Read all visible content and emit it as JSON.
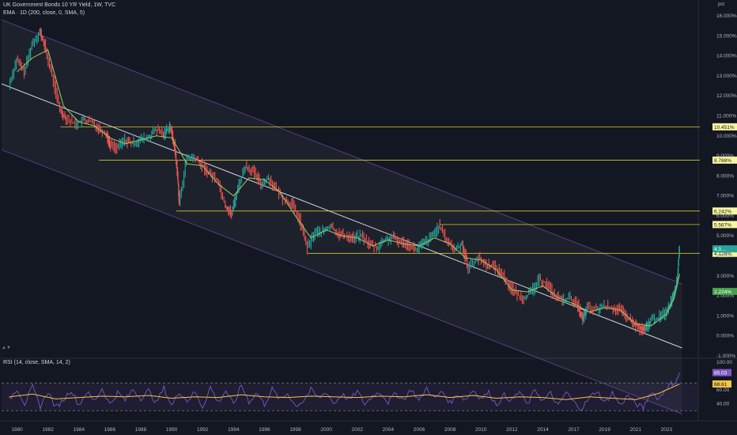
{
  "header": {
    "title": "UK Government Bonds 10 YR Yield, 1W, TVC",
    "ema_legend": "EMA · 1D (200, close, 0, SMA, 5)",
    "rsi_legend": "RSI (14, close, SMA, 14, 2)",
    "unit": "pct"
  },
  "colors": {
    "background": "#131722",
    "up": "#26a69a",
    "down": "#ef5350",
    "ema": "#9ccc65",
    "trendline": "#d1d4dc",
    "channel": "#7e57c2",
    "level": "#d4c62a",
    "label_bg": "#fbf7a0",
    "rsi": "#7e57c2",
    "rsi_ma": "#f5c542"
  },
  "chart_data": [
    {
      "type": "line",
      "title": "UK Government Bonds 10 YR Yield, 1W, TVC",
      "xlabel": "",
      "ylabel": "pct",
      "x_range": [
        1979.0,
        2024.0
      ],
      "ylim": [
        -1.0,
        16.0
      ],
      "grid": false,
      "x_tick_labels": [
        "1980",
        "1982",
        "1984",
        "1986",
        "1988",
        "1990",
        "1992",
        "1994",
        "1996",
        "1998",
        "2000",
        "2002",
        "2004",
        "2006",
        "2008",
        "2010",
        "2012",
        "2014",
        "2017",
        "2019",
        "2021",
        "2023"
      ],
      "x_tick_positions": [
        1980,
        1982,
        1984,
        1986,
        1988,
        1990,
        1992,
        1994,
        1996,
        1998,
        2000,
        2002,
        2004,
        2006,
        2008,
        2010,
        2012,
        2014,
        2016,
        2018,
        2020,
        2022
      ],
      "y_tick_labels": [
        "16.000%",
        "15.000%",
        "14.000%",
        "13.000%",
        "12.000%",
        "11.000%",
        "10.000%",
        "9.000%",
        "8.000%",
        "7.000%",
        "6.000%",
        "5.000%",
        "4.000%",
        "3.000%",
        "2.000%",
        "1.000%",
        "0.000%",
        "-1.000%"
      ],
      "y_ticks": [
        16,
        15,
        14,
        13,
        12,
        11,
        10,
        9,
        8,
        7,
        6,
        5,
        4,
        3,
        2,
        1,
        0,
        -1
      ],
      "series": [
        {
          "kind": "price",
          "x": [
            1979.5,
            1980.0,
            1980.5,
            1981.0,
            1981.5,
            1981.8,
            1982.3,
            1982.8,
            1983.2,
            1983.8,
            1984.3,
            1984.8,
            1985.3,
            1985.8,
            1986.0,
            1986.5,
            1987.0,
            1987.5,
            1988.0,
            1988.5,
            1989.0,
            1989.5,
            1989.9,
            1990.2,
            1990.4,
            1990.5,
            1991.0,
            1991.5,
            1992.0,
            1992.5,
            1993.0,
            1993.5,
            1993.9,
            1994.3,
            1994.8,
            1995.3,
            1995.8,
            1996.3,
            1996.8,
            1997.3,
            1997.8,
            1998.3,
            1998.8,
            1999.3,
            1999.8,
            2000.3,
            2000.8,
            2001.3,
            2001.8,
            2002.3,
            2002.8,
            2003.3,
            2003.8,
            2004.3,
            2004.8,
            2005.3,
            2005.8,
            2006.3,
            2006.8,
            2007.3,
            2007.8,
            2008.3,
            2008.8,
            2009.2,
            2009.8,
            2010.3,
            2010.8,
            2011.3,
            2011.8,
            2012.3,
            2012.8,
            2013.3,
            2013.8,
            2014.3,
            2014.8,
            2015.3,
            2015.8,
            2016.3,
            2016.6,
            2016.9,
            2017.5,
            2018.0,
            2018.5,
            2019.0,
            2019.5,
            2019.9,
            2020.3,
            2020.6,
            2021.0,
            2021.5,
            2022.0,
            2022.3,
            2022.5,
            2022.7,
            2022.85
          ],
          "values": [
            12.5,
            13.8,
            13.2,
            14.6,
            15.2,
            14.5,
            13.0,
            11.3,
            10.9,
            10.6,
            10.8,
            10.7,
            10.4,
            10.1,
            9.6,
            9.4,
            9.8,
            9.6,
            9.8,
            9.9,
            10.3,
            10.1,
            10.5,
            9.5,
            8.0,
            6.6,
            8.9,
            8.9,
            8.5,
            8.1,
            7.8,
            6.5,
            6.1,
            7.4,
            8.5,
            8.2,
            7.6,
            7.9,
            7.3,
            6.8,
            6.6,
            5.8,
            4.4,
            5.2,
            5.2,
            5.5,
            5.1,
            5.0,
            4.9,
            5.0,
            4.6,
            4.4,
            4.8,
            4.9,
            4.7,
            4.6,
            4.3,
            4.6,
            4.9,
            5.5,
            4.8,
            4.3,
            4.6,
            3.4,
            3.9,
            3.6,
            3.5,
            3.2,
            2.6,
            2.1,
            1.9,
            2.2,
            2.8,
            2.6,
            2.0,
            1.8,
            1.9,
            1.5,
            0.8,
            1.4,
            1.3,
            1.5,
            1.4,
            1.3,
            0.9,
            0.6,
            0.35,
            0.25,
            0.8,
            0.9,
            1.2,
            1.7,
            2.2,
            2.7,
            4.5
          ]
        },
        {
          "kind": "ema",
          "name": "EMA",
          "x": [
            1980.0,
            1981.0,
            1982.0,
            1983.0,
            1984.0,
            1985.0,
            1986.0,
            1987.0,
            1988.0,
            1989.0,
            1990.0,
            1991.0,
            1992.0,
            1993.0,
            1994.0,
            1995.0,
            1996.0,
            1997.0,
            1998.0,
            1999.0,
            2000.0,
            2001.0,
            2002.0,
            2003.0,
            2004.0,
            2005.0,
            2006.0,
            2007.0,
            2008.0,
            2009.0,
            2010.0,
            2011.0,
            2012.0,
            2013.0,
            2014.0,
            2015.0,
            2016.0,
            2017.0,
            2018.0,
            2019.0,
            2020.0,
            2021.0,
            2022.0,
            2022.5,
            2022.85
          ],
          "values": [
            13.2,
            13.9,
            14.3,
            11.5,
            10.7,
            10.5,
            9.9,
            9.6,
            9.8,
            10.0,
            9.9,
            8.6,
            8.5,
            7.6,
            7.0,
            7.9,
            7.8,
            7.2,
            6.0,
            4.9,
            5.3,
            5.0,
            4.9,
            4.5,
            4.8,
            4.6,
            4.5,
            4.9,
            4.6,
            3.9,
            3.8,
            3.3,
            2.3,
            2.2,
            2.5,
            1.9,
            1.6,
            1.2,
            1.4,
            1.3,
            0.6,
            0.5,
            1.1,
            1.9,
            3.1
          ]
        }
      ],
      "trendline": {
        "x": [
          1979.0,
          2023.0
        ],
        "values": [
          12.6,
          -0.6
        ]
      },
      "channel": {
        "upper": {
          "x": [
            1979.0,
            2023.0
          ],
          "values": [
            15.8,
            2.6
          ]
        },
        "lower": {
          "x": [
            1979.0,
            2023.0
          ],
          "values": [
            9.3,
            -3.9
          ]
        }
      },
      "levels": [
        {
          "value": 10.451,
          "label": "10.451%",
          "from": 1982.8
        },
        {
          "value": 8.788,
          "label": "8.788%",
          "from": 1985.3
        },
        {
          "value": 6.242,
          "label": "6.242%",
          "from": 1990.3
        },
        {
          "value": 5.567,
          "label": "5.567%",
          "from": 2007.3
        },
        {
          "value": 4.128,
          "label": "4.128%",
          "from": 1998.8
        }
      ],
      "price_labels": [
        {
          "value": 4.35,
          "label": "4.3…",
          "kind": "price"
        },
        {
          "value": 2.224,
          "label": "2.224%",
          "kind": "ema"
        }
      ]
    },
    {
      "type": "line",
      "title": "RSI (14, close, SMA, 14, 2)",
      "x_range": [
        1979.0,
        2024.0
      ],
      "ylim": [
        20,
        100
      ],
      "y_tick_labels": [
        "100.00",
        "60.00",
        "40.00"
      ],
      "y_ticks": [
        100,
        60,
        40
      ],
      "bands": [
        70,
        30
      ],
      "series": [
        {
          "name": "RSI",
          "x": [
            1979.5,
            1980.0,
            1980.5,
            1981.0,
            1981.5,
            1982.0,
            1982.5,
            1983.0,
            1983.5,
            1984.0,
            1984.5,
            1985.0,
            1985.5,
            1986.0,
            1986.5,
            1987.0,
            1987.5,
            1988.0,
            1988.5,
            1989.0,
            1989.5,
            1990.0,
            1990.5,
            1991.0,
            1991.5,
            1992.0,
            1992.5,
            1993.0,
            1993.5,
            1994.0,
            1994.5,
            1995.0,
            1995.5,
            1996.0,
            1996.5,
            1997.0,
            1997.5,
            1998.0,
            1998.5,
            1999.0,
            1999.5,
            2000.0,
            2000.5,
            2001.0,
            2001.5,
            2002.0,
            2002.5,
            2003.0,
            2003.5,
            2004.0,
            2004.5,
            2005.0,
            2005.5,
            2006.0,
            2006.5,
            2007.0,
            2007.5,
            2008.0,
            2008.5,
            2009.0,
            2009.5,
            2010.0,
            2010.5,
            2011.0,
            2011.5,
            2012.0,
            2012.5,
            2013.0,
            2013.5,
            2014.0,
            2014.5,
            2015.0,
            2015.5,
            2016.0,
            2016.5,
            2017.0,
            2017.5,
            2018.0,
            2018.5,
            2019.0,
            2019.5,
            2020.0,
            2020.5,
            2021.0,
            2021.5,
            2022.0,
            2022.3,
            2022.6,
            2022.85
          ],
          "values": [
            46,
            62,
            40,
            64,
            36,
            58,
            34,
            46,
            60,
            38,
            57,
            44,
            62,
            39,
            56,
            45,
            61,
            48,
            59,
            41,
            63,
            37,
            58,
            44,
            57,
            35,
            64,
            42,
            59,
            38,
            67,
            43,
            56,
            39,
            61,
            46,
            55,
            37,
            44,
            60,
            48,
            57,
            40,
            54,
            45,
            58,
            39,
            52,
            57,
            42,
            55,
            46,
            61,
            44,
            63,
            47,
            58,
            41,
            54,
            46,
            60,
            48,
            56,
            39,
            52,
            45,
            58,
            38,
            61,
            44,
            55,
            36,
            57,
            42,
            33,
            48,
            59,
            41,
            56,
            38,
            52,
            40,
            34,
            58,
            47,
            63,
            69,
            71,
            85
          ]
        },
        {
          "name": "RSI MA",
          "x": [
            1979.5,
            1981.0,
            1982.5,
            1984.0,
            1985.5,
            1987.0,
            1988.5,
            1990.0,
            1991.5,
            1993.0,
            1994.5,
            1996.0,
            1997.5,
            1999.0,
            2000.5,
            2002.0,
            2003.5,
            2005.0,
            2006.5,
            2008.0,
            2009.5,
            2011.0,
            2012.5,
            2014.0,
            2015.5,
            2017.0,
            2018.5,
            2020.0,
            2021.5,
            2022.85
          ],
          "values": [
            50,
            54,
            47,
            49,
            51,
            50,
            52,
            48,
            50,
            49,
            53,
            50,
            49,
            51,
            50,
            49,
            51,
            50,
            53,
            49,
            52,
            48,
            50,
            49,
            46,
            50,
            48,
            46,
            55,
            68.61
          ]
        }
      ],
      "value_labels": [
        {
          "value": 85.03,
          "label": "85.03",
          "series": "RSI"
        },
        {
          "value": 68.61,
          "label": "68.61",
          "series": "RSI MA"
        }
      ]
    }
  ]
}
